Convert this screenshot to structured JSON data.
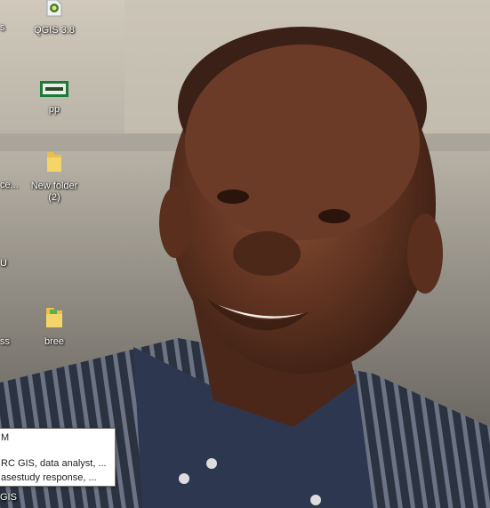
{
  "desktop": {
    "icons": [
      {
        "label": "QGIS 3.8",
        "icon": "qgis-icon"
      },
      {
        "label": "pp",
        "icon": "image-file-icon"
      },
      {
        "label": "New folder (2)",
        "icon": "folder-icon"
      },
      {
        "label": "bree",
        "icon": "folder-icon"
      }
    ],
    "left_edge_labels": [
      "s",
      "ce...",
      "U",
      "ss",
      "GIS"
    ]
  },
  "tooltip": {
    "line1": "M",
    "line2": "RC GIS, data analyst, ...",
    "line3": "asestudy response, ..."
  },
  "colors": {
    "folder": "#e8c04a",
    "tooltip_bg": "#ffffff",
    "tooltip_border": "#767676"
  }
}
